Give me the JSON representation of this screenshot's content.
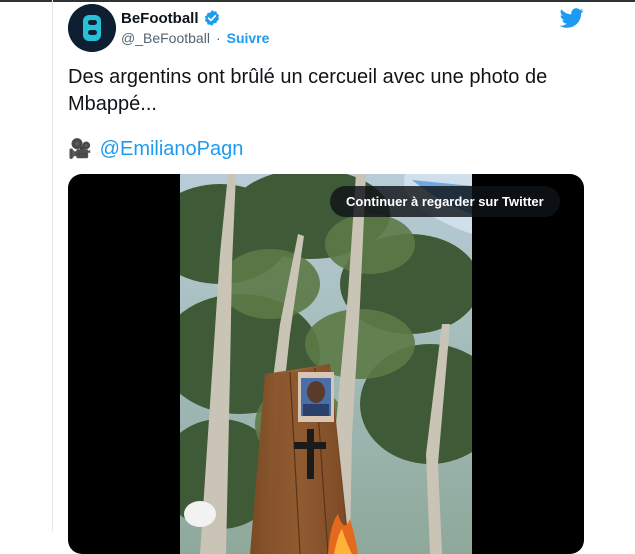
{
  "tweet": {
    "author": {
      "display_name": "BeFootball",
      "handle": "@_BeFootball",
      "separator": "·",
      "follow_label": "Suivre",
      "verified": true,
      "avatar_letter": "B"
    },
    "text": "Des argentins ont brûlé un cercueil avec une photo de Mbappé...",
    "credit": {
      "icon": "video-camera-icon",
      "glyph": "🎥",
      "mention": "@EmilianoPagn"
    },
    "media": {
      "type": "video",
      "continue_label": "Continuer à regarder sur Twitter"
    }
  },
  "colors": {
    "link_blue": "#1d9bf0",
    "text_dark": "#0f1419",
    "text_gray": "#536471",
    "twitter_blue": "#1d9bf0"
  }
}
